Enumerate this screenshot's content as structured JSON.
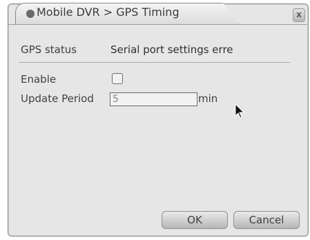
{
  "dialog": {
    "title": "Mobile DVR > GPS Timing",
    "close_glyph": "x"
  },
  "fields": {
    "gps_status_label": "GPS status",
    "gps_status_value": "Serial port settings erre",
    "enable_label": "Enable",
    "enable_checked": false,
    "update_period_label": "Update Period",
    "update_period_value": "5",
    "update_period_unit": "min"
  },
  "buttons": {
    "ok": "OK",
    "cancel": "Cancel"
  },
  "icons": {
    "title_bullet": "circle-bullet-icon",
    "close": "close-icon",
    "pointer": "mouse-pointer-icon"
  }
}
